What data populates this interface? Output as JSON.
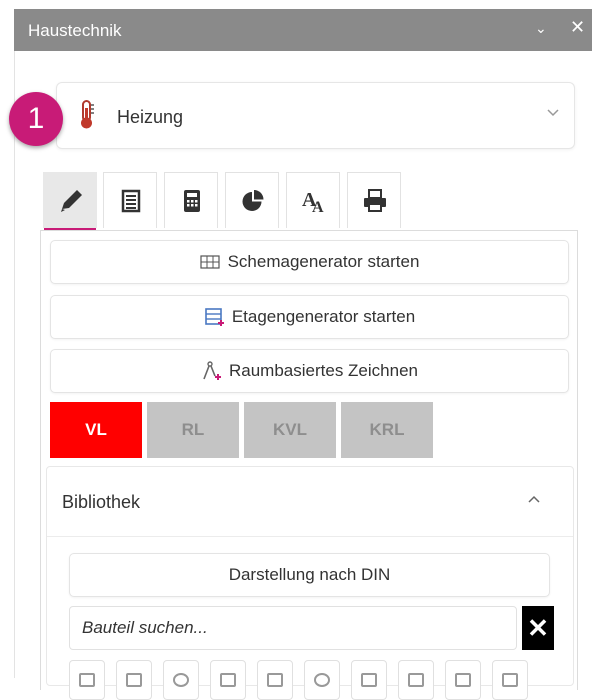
{
  "window": {
    "title": "Haustechnik"
  },
  "badge": {
    "number": "1"
  },
  "discipline": {
    "selected": "Heizung",
    "icon": "thermometer-icon"
  },
  "tabs": [
    {
      "icon": "pencil-icon",
      "active": true
    },
    {
      "icon": "list-icon",
      "active": false
    },
    {
      "icon": "calculator-icon",
      "active": false
    },
    {
      "icon": "pie-chart-icon",
      "active": false
    },
    {
      "icon": "font-icon",
      "active": false
    },
    {
      "icon": "printer-icon",
      "active": false
    }
  ],
  "actions": {
    "schema": "Schemagenerator starten",
    "etage": "Etagengenerator starten",
    "raum": "Raumbasiertes Zeichnen"
  },
  "pipes": [
    {
      "label": "VL",
      "active": true
    },
    {
      "label": "RL",
      "active": false
    },
    {
      "label": "KVL",
      "active": false
    },
    {
      "label": "KRL",
      "active": false
    }
  ],
  "library": {
    "title": "Bibliothek",
    "din_button": "Darstellung nach DIN",
    "search_placeholder": "Bauteil suchen..."
  },
  "colors": {
    "accent": "#c81b77",
    "active_pipe": "#ff0000",
    "inactive_pipe": "#c4c4c4",
    "titlebar": "#8a8a8a"
  }
}
